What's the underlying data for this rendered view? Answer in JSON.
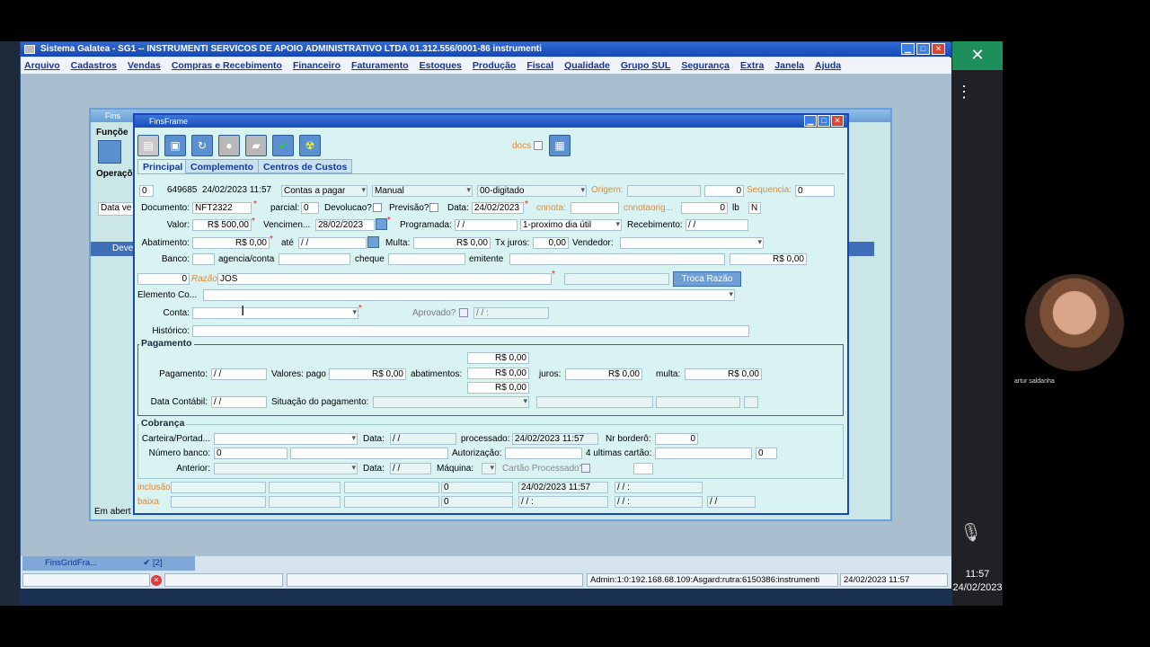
{
  "app": {
    "title": "Sistema Galatea - SG1 -- INSTRUMENTI SERVICOS DE APOIO ADMINISTRATIVO LTDA   01.312.556/0001-86   instrumenti",
    "menu": [
      "Arquivo",
      "Cadastros",
      "Vendas",
      "Compras e Recebimento",
      "Financeiro",
      "Faturamento",
      "Estoques",
      "Produção",
      "Fiscal",
      "Qualidade",
      "Grupo SUL",
      "Segurança",
      "Extra",
      "Janela",
      "Ajuda"
    ]
  },
  "bg_frame": {
    "title": "Fins",
    "funcoes": "Funçõe",
    "operacoes": "Operaçõ",
    "data_label": "Data ve",
    "col": "Deve",
    "status": "Em abert"
  },
  "frame": {
    "title": "FinsFrame",
    "docs_label": "docs",
    "tabs": [
      "Principal",
      "Complemento",
      "Centros de Custos"
    ],
    "row1": {
      "seq0": "0",
      "id": "649685",
      "datetime": "24/02/2023 11:57",
      "tipo": "Contas a pagar",
      "modo": "Manual",
      "status": "00-digitado",
      "origem_label": "Origem:",
      "origem_val": "0",
      "sequencia_label": "Sequencia:",
      "sequencia_val": "0"
    },
    "row2": {
      "documento_label": "Documento:",
      "documento": "NFT2322",
      "parcial_label": "parcial:",
      "parcial": "0",
      "devolucao_label": "Devolucao?",
      "previsao_label": "Previsão?",
      "data_label": "Data:",
      "data": "24/02/2023",
      "cnnota_label": "cnnota:",
      "cnnotaorig_label": "cnnotaorig...",
      "cnnotaorig": "0",
      "lb": "lb",
      "n": "N"
    },
    "row3": {
      "valor_label": "Valor:",
      "valor": "R$ 500,00",
      "venc_label": "Vencimen...",
      "venc": "28/02/2023",
      "prog_label": "Programada:",
      "prog": "/ /",
      "prox": "1-proximo dia útil",
      "receb_label": "Recebimento:",
      "receb": "/ /"
    },
    "row4": {
      "abat_label": "Abatimento:",
      "abat": "R$ 0,00",
      "ate_label": "até",
      "ate": "/ /",
      "multa_label": "Multa:",
      "multa": "R$ 0,00",
      "tx_label": "Tx juros:",
      "tx": "0,00",
      "vend_label": "Vendedor:"
    },
    "row5": {
      "banco_label": "Banco:",
      "agencia_label": "agencia/conta",
      "cheque_label": "cheque",
      "emitente_label": "emitente",
      "total": "R$ 0,00"
    },
    "row6": {
      "num": "0",
      "razao_label": "Razão",
      "razao": "JOS",
      "troca": "Troca Razão"
    },
    "row7": {
      "elemento_label": "Elemento Co..."
    },
    "row8": {
      "conta_label": "Conta:",
      "aprovado_label": "Aprovado?",
      "aprov_date": "/ /   :"
    },
    "row9": {
      "historico_label": "Histórico:"
    },
    "pagamento": {
      "title": "Pagamento",
      "pag_label": "Pagamento:",
      "pag": "/ /",
      "valores_label": "Valores: pago",
      "valores": "R$ 0,00",
      "abat_label": "abatimentos:",
      "abat_top": "R$ 0,00",
      "abat_mid": "R$ 0,00",
      "abat_bot": "R$ 0,00",
      "juros_label": "juros:",
      "juros": "R$ 0,00",
      "multa_label": "multa:",
      "multa": "R$ 0,00",
      "contabil_label": "Data Contábil:",
      "contabil": "/ /",
      "situacao_label": "Situação do pagamento:"
    },
    "cobranca": {
      "title": "Cobrança",
      "carteira_label": "Carteira/Portad...",
      "data_label": "Data:",
      "data": "/ /",
      "processado_label": "processado:",
      "processado": "24/02/2023 11:57",
      "bordero_label": "Nr borderô:",
      "bordero": "0",
      "numbanco_label": "Número banco:",
      "numbanco": "0",
      "autoriz_label": "Autorização:",
      "cartao_label": "4 ultimas cartão:",
      "cartao": "0",
      "anterior_label": "Anterior:",
      "data2_label": "Data:",
      "data2": "/ /",
      "maquina_label": "Máquina:",
      "cproc_label": "Cartão Processado?"
    },
    "footer": {
      "inclusao": "inclusão",
      "inc_num": "0",
      "inc_dt": "24/02/2023 11:57",
      "inc_dt2": "/ /   :",
      "baixa": "baixa",
      "bx_num": "0",
      "bx_dt": "/ /   :",
      "bx_dt2": "/ /   :",
      "bx_dt3": "/ /"
    }
  },
  "taskbar": {
    "task1": "FinsGridFra...",
    "task2": "[2]"
  },
  "status": {
    "info": "Admin:1:0:192.168.68.109:Asgard:rutra:6150386:instrumenti",
    "datetime": "24/02/2023 11:57"
  },
  "meeting": {
    "person": "artur saldanha",
    "clock": "11:57",
    "date": "24/02/2023"
  }
}
